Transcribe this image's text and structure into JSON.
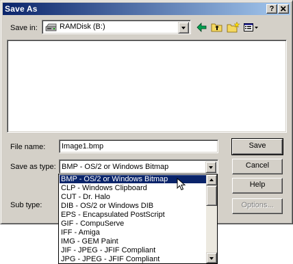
{
  "window": {
    "title": "Save As",
    "help_button": "?",
    "close_button": "✕"
  },
  "save_in": {
    "label": "Save in:",
    "value": "RAMDisk (B:)"
  },
  "toolbar": {
    "back": "back-arrow-icon",
    "up_folder": "up-one-level-icon",
    "new_folder": "new-folder-icon",
    "view_menu": "view-menu-icon"
  },
  "file_name": {
    "label": "File name:",
    "value": "Image1.bmp"
  },
  "save_as_type": {
    "label": "Save as type:",
    "value": "BMP - OS/2 or Windows Bitmap"
  },
  "sub_type": {
    "label": "Sub type:"
  },
  "buttons": {
    "save": "Save",
    "cancel": "Cancel",
    "help": "Help",
    "options": "Options..."
  },
  "type_list": {
    "selected_index": 0,
    "items": [
      "BMP - OS/2 or Windows Bitmap",
      "CLP - Windows Clipboard",
      "CUT - Dr. Halo",
      "DIB - OS/2 or Windows DIB",
      "EPS - Encapsulated PostScript",
      "GIF - CompuServe",
      "IFF - Amiga",
      "IMG - GEM Paint",
      "JIF - JPEG - JFIF Compliant",
      "JPG - JPEG - JFIF Compliant"
    ]
  },
  "colors": {
    "dialog_face": "#d4d0c8",
    "title_active": "#0a246a",
    "selection": "#0a246a"
  }
}
